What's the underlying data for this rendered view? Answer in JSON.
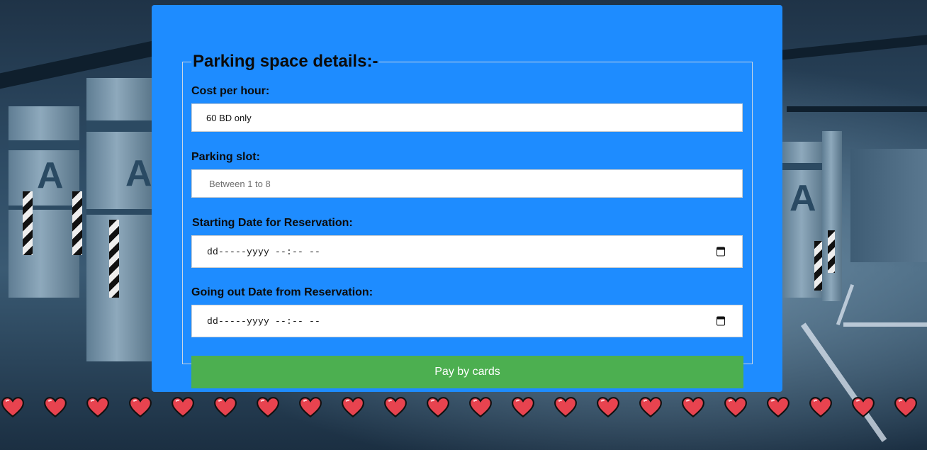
{
  "form": {
    "legend": "Parking space details:-",
    "cost_label": "Cost per hour:",
    "cost_value": "60 BD only",
    "slot_label": "Parking slot:",
    "slot_placeholder": "Between 1 to 8",
    "start_label": "Starting Date for Reservation:",
    "start_value": "dd-----yyyy --:-- --",
    "end_label": "Going out Date from Reservation:",
    "end_value": "dd-----yyyy --:-- --",
    "pay_button": "Pay by cards"
  },
  "colors": {
    "card": "#1e8cff",
    "button": "#4caf50",
    "heart": "#e8434f"
  },
  "icons": {
    "calendar": "calendar-icon",
    "heart": "heart-icon"
  },
  "decor": {
    "heart_count": 22
  }
}
